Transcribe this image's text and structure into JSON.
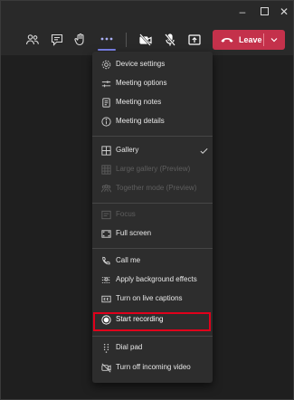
{
  "window": {
    "controls": [
      {
        "name": "minimize",
        "glyph": "–"
      },
      {
        "name": "maximize",
        "glyph": ""
      },
      {
        "name": "close",
        "glyph": "✕"
      }
    ]
  },
  "toolbar": {
    "icons": [
      "participants-icon",
      "chat-icon",
      "raise-hand-icon",
      "more-actions-icon",
      "camera-off-icon",
      "mic-off-icon",
      "share-tray-icon"
    ],
    "leave_label": "Leave",
    "leave_color": "#c4314b",
    "active_indicator_color": "#7b83eb"
  },
  "menu": {
    "items": [
      {
        "label": "Device settings",
        "icon": "gear-icon",
        "disabled": false
      },
      {
        "label": "Meeting options",
        "icon": "sliders-icon",
        "disabled": false
      },
      {
        "label": "Meeting notes",
        "icon": "notes-icon",
        "disabled": false
      },
      {
        "label": "Meeting details",
        "icon": "info-icon",
        "disabled": false
      },
      {
        "label": "Gallery",
        "icon": "grid-icon",
        "disabled": false,
        "checked": true
      },
      {
        "label": "Large gallery (Preview)",
        "icon": "large-grid-icon",
        "disabled": true
      },
      {
        "label": "Together mode (Preview)",
        "icon": "together-icon",
        "disabled": true
      },
      {
        "label": "Focus",
        "icon": "focus-icon",
        "disabled": true
      },
      {
        "label": "Full screen",
        "icon": "fullscreen-icon",
        "disabled": false
      },
      {
        "label": "Call me",
        "icon": "phone-icon",
        "disabled": false
      },
      {
        "label": "Apply background effects",
        "icon": "background-effects-icon",
        "disabled": false
      },
      {
        "label": "Turn on live captions",
        "icon": "captions-icon",
        "disabled": false
      },
      {
        "label": "Start recording",
        "icon": "record-icon",
        "disabled": false,
        "highlighted": true
      },
      {
        "label": "Dial pad",
        "icon": "dialpad-icon",
        "disabled": false
      },
      {
        "label": "Turn off incoming video",
        "icon": "video-off-icon",
        "disabled": false
      }
    ]
  },
  "colors": {
    "highlight_box": "#e0001b",
    "menu_bg": "#2d2d2d"
  }
}
